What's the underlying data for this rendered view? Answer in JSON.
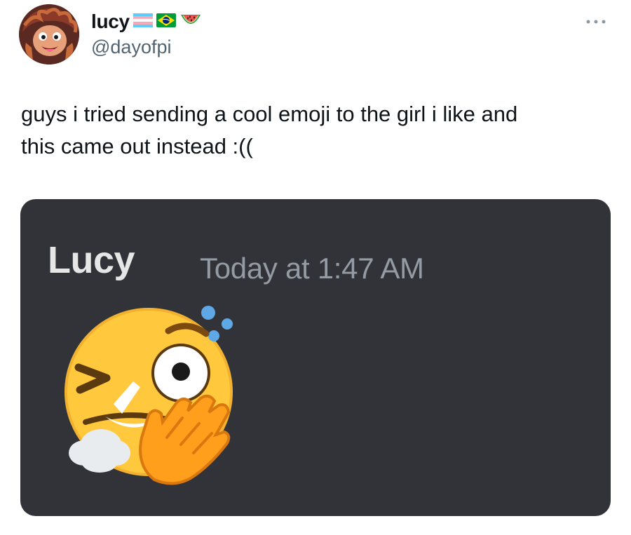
{
  "tweet": {
    "display_name": "lucy",
    "name_emojis": [
      "transgender-flag-icon",
      "brazil-flag-icon",
      "watermelon-icon"
    ],
    "handle": "@dayofpi",
    "more_icon": "more-dots-icon",
    "text_line1": "guys i tried sending a cool emoji to the girl i like and",
    "text_line2": "this came out instead :(("
  },
  "media": {
    "author": "Lucy",
    "timestamp": "Today at 1:47 AM",
    "emoji": "flushed-wink-emoji",
    "background": "#313338"
  },
  "colors": {
    "text": "#0f1419",
    "secondary": "#536471",
    "discord_name": "#e6e6e6",
    "discord_time": "#949ba4"
  }
}
